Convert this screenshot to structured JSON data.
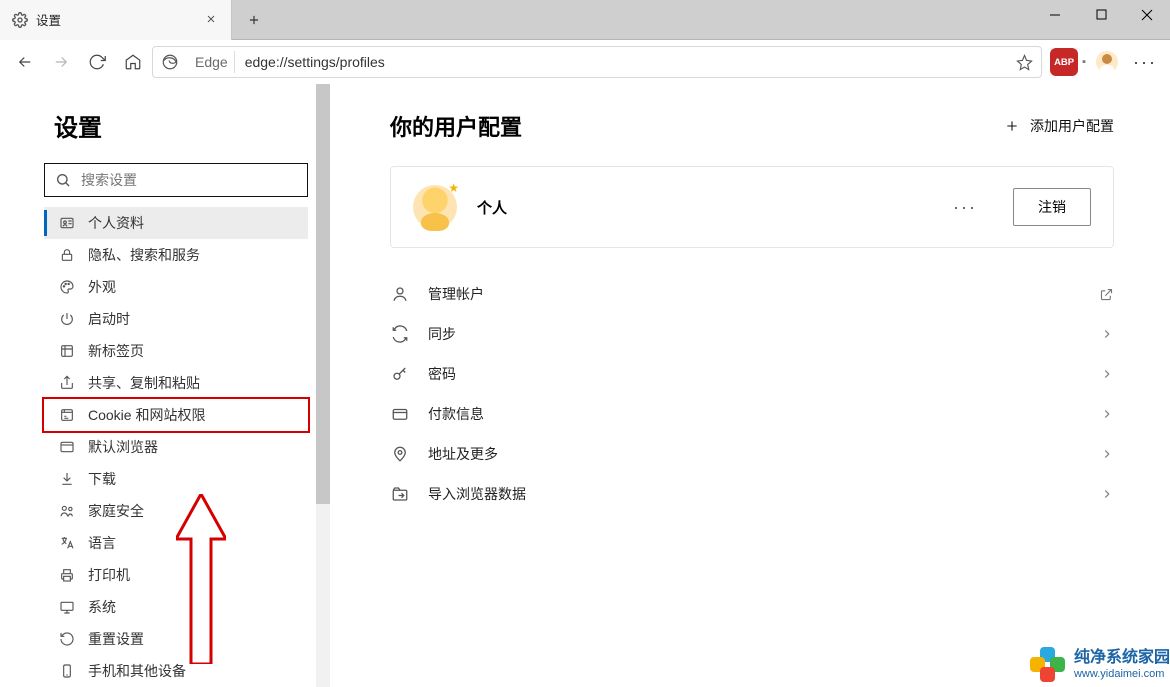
{
  "tab": {
    "title": "设置"
  },
  "address": {
    "browser_label": "Edge",
    "url": "edge://settings/profiles",
    "abp": "ABP"
  },
  "sidebar": {
    "title": "设置",
    "search_placeholder": "搜索设置",
    "items": [
      {
        "label": "个人资料"
      },
      {
        "label": "隐私、搜索和服务"
      },
      {
        "label": "外观"
      },
      {
        "label": "启动时"
      },
      {
        "label": "新标签页"
      },
      {
        "label": "共享、复制和粘贴"
      },
      {
        "label": "Cookie 和网站权限"
      },
      {
        "label": "默认浏览器"
      },
      {
        "label": "下载"
      },
      {
        "label": "家庭安全"
      },
      {
        "label": "语言"
      },
      {
        "label": "打印机"
      },
      {
        "label": "系统"
      },
      {
        "label": "重置设置"
      },
      {
        "label": "手机和其他设备"
      }
    ]
  },
  "main": {
    "heading": "你的用户配置",
    "add_profile": "添加用户配置",
    "profile_name": "个人",
    "logout": "注销",
    "rows": [
      {
        "label": "管理帐户"
      },
      {
        "label": "同步"
      },
      {
        "label": "密码"
      },
      {
        "label": "付款信息"
      },
      {
        "label": "地址及更多"
      },
      {
        "label": "导入浏览器数据"
      }
    ]
  },
  "watermark": {
    "cn": "纯净系统家园",
    "url": "www.yidaimei.com"
  }
}
